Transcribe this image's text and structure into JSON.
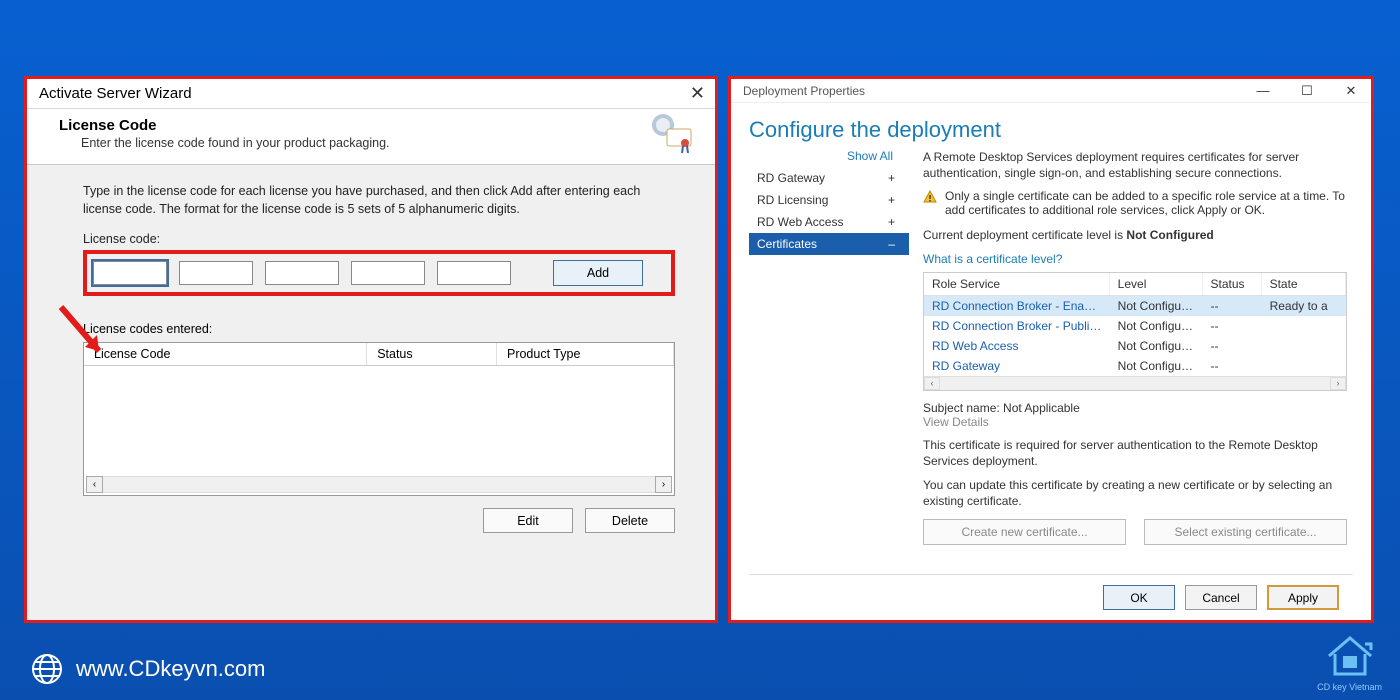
{
  "left": {
    "title": "Activate Server Wizard",
    "heading": "License Code",
    "subheading": "Enter the license code found in your product packaging.",
    "instructions": "Type in the license code for each license you have purchased, and then click Add after entering each license code. The format for the license code is 5 sets of 5 alphanumeric digits.",
    "code_label": "License code:",
    "add_btn": "Add",
    "entered_label": "License codes entered:",
    "cols": {
      "c1": "License Code",
      "c2": "Status",
      "c3": "Product Type"
    },
    "edit_btn": "Edit",
    "delete_btn": "Delete"
  },
  "right": {
    "title": "Deployment Properties",
    "heading": "Configure the deployment",
    "show_all": "Show All",
    "nav": [
      {
        "label": "RD Gateway",
        "sym": "+"
      },
      {
        "label": "RD Licensing",
        "sym": "+"
      },
      {
        "label": "RD Web Access",
        "sym": "+"
      },
      {
        "label": "Certificates",
        "sym": "–"
      }
    ],
    "intro": "A Remote Desktop Services deployment requires certificates for server authentication, single sign-on, and establishing secure connections.",
    "warn": "Only a single certificate can be added to a specific role service at a time. To add certificates to additional role services, click Apply or OK.",
    "level_pre": "Current deployment certificate level is ",
    "level_val": "Not Configured",
    "level_link": "What is a certificate level?",
    "thead": {
      "c1": "Role Service",
      "c2": "Level",
      "c3": "Status",
      "c4": "State"
    },
    "rows": [
      {
        "c1": "RD Connection Broker - Enable Sing",
        "c2": "Not Configured",
        "c3": "--",
        "c4": "Ready to a"
      },
      {
        "c1": "RD Connection Broker - Publishing",
        "c2": "Not Configured",
        "c3": "--",
        "c4": ""
      },
      {
        "c1": "RD Web Access",
        "c2": "Not Configured",
        "c3": "--",
        "c4": ""
      },
      {
        "c1": "RD Gateway",
        "c2": "Not Configured",
        "c3": "--",
        "c4": ""
      }
    ],
    "subject": "Subject name: Not Applicable",
    "view_details": "View Details",
    "cert_text": "This certificate is required for server authentication to the Remote Desktop Services deployment.",
    "cert_update": "You can update this certificate by creating a new certificate or by selecting an existing certificate.",
    "create_btn": "Create new certificate...",
    "select_btn": "Select existing certificate...",
    "ok": "OK",
    "cancel": "Cancel",
    "apply": "Apply"
  },
  "footer": {
    "url": "www.CDkeyvn.com",
    "logo_caption": "CD key Vietnam"
  }
}
